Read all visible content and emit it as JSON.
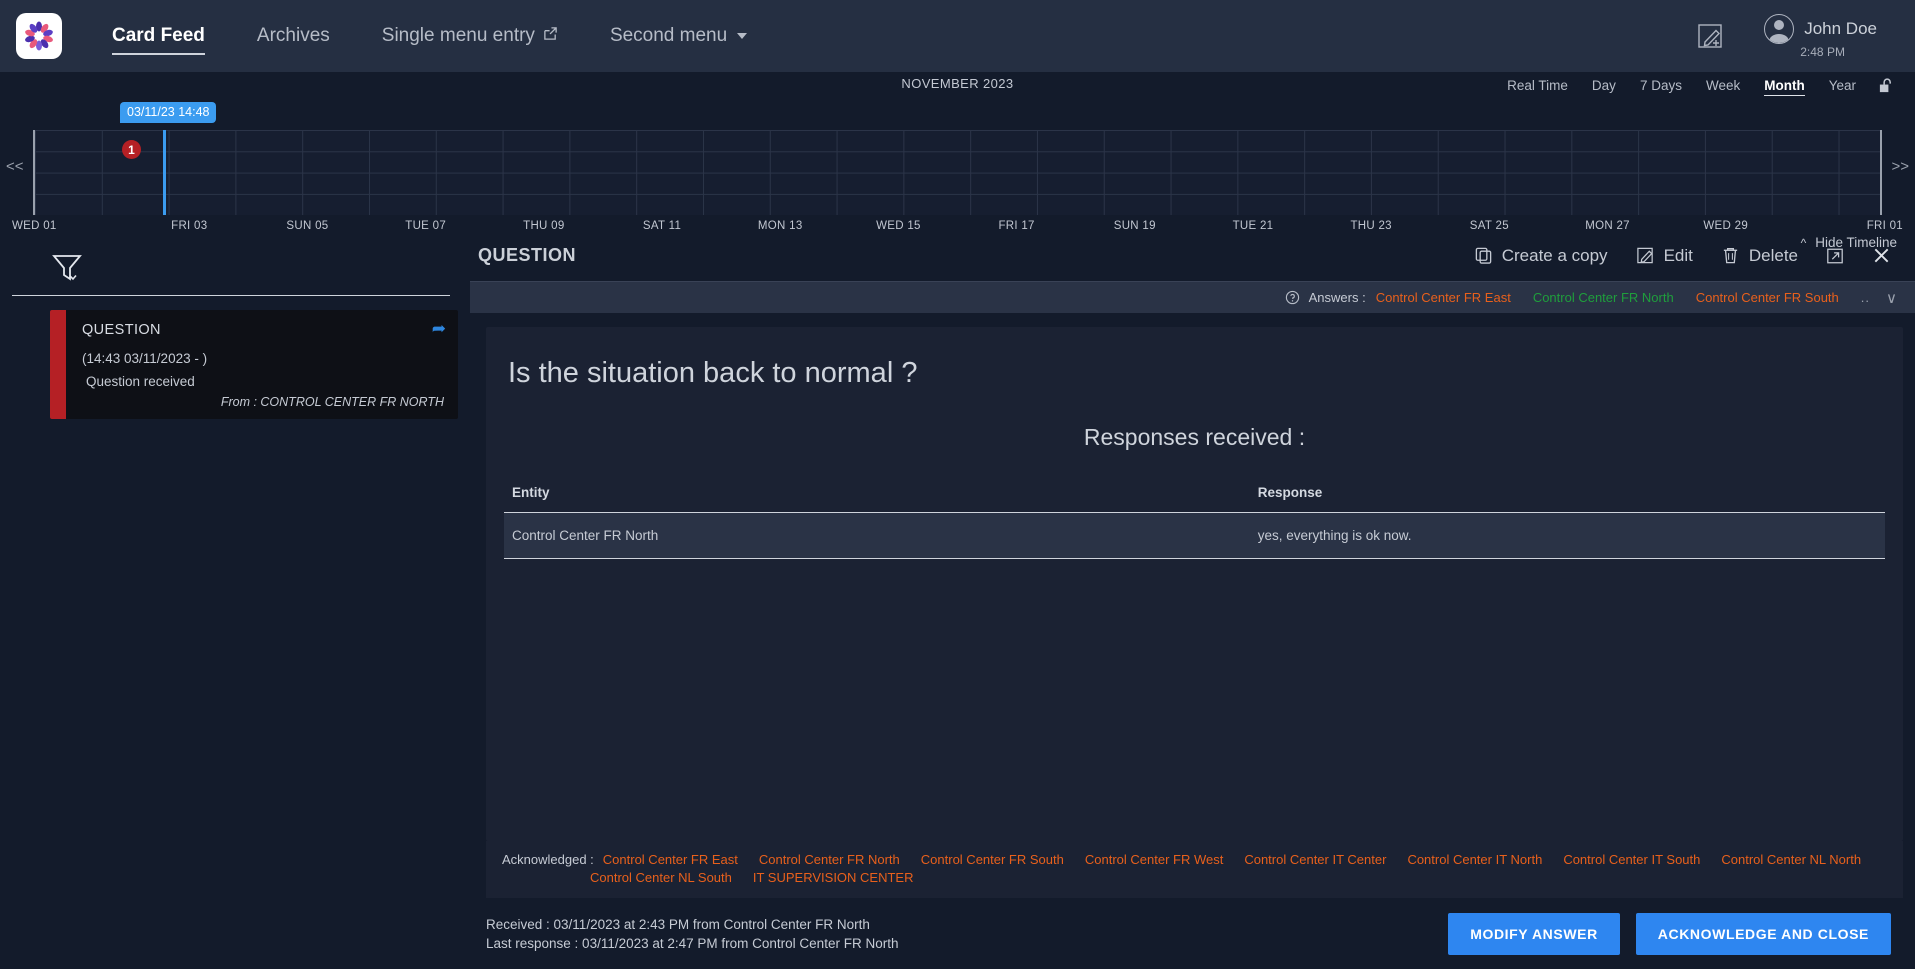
{
  "header": {
    "logo_icon": "flower-ring-logo",
    "nav": [
      {
        "label": "Card Feed",
        "active": true,
        "icon": null
      },
      {
        "label": "Archives",
        "active": false,
        "icon": null
      },
      {
        "label": "Single menu entry",
        "active": false,
        "icon": "external-link-icon"
      },
      {
        "label": "Second menu",
        "active": false,
        "icon": "chevron-down-icon"
      }
    ],
    "create_card_icon": "pencil-square-plus-icon",
    "user": {
      "name": "John Doe",
      "time": "2:48 PM",
      "avatar_icon": "user-avatar-icon"
    }
  },
  "timeline": {
    "month_label": "NOVEMBER 2023",
    "periods": [
      {
        "label": "Real Time",
        "active": false
      },
      {
        "label": "Day",
        "active": false
      },
      {
        "label": "7 Days",
        "active": false
      },
      {
        "label": "Week",
        "active": false
      },
      {
        "label": "Month",
        "active": true
      },
      {
        "label": "Year",
        "active": false
      }
    ],
    "lock_icon": "padlock-open-icon",
    "prev_label": "<<",
    "next_label": ">>",
    "cursor_label": "03/11/23 14:48",
    "marker_count": "1",
    "ticks": [
      "WED 01",
      "FRI 03",
      "SUN 05",
      "TUE 07",
      "THU 09",
      "SAT 11",
      "MON 13",
      "WED 15",
      "FRI 17",
      "SUN 19",
      "TUE 21",
      "THU 23",
      "SAT 25",
      "MON 27",
      "WED 29",
      "FRI 01"
    ],
    "hide_label": "Hide Timeline",
    "hide_chevron": "^"
  },
  "sidebar": {
    "filter_icon": "funnel-filter-icon",
    "card": {
      "title": "QUESTION",
      "time": "(14:43 03/11/2023 - )",
      "status": "Question received",
      "from": "From : CONTROL CENTER FR NORTH",
      "reply_icon": "reply-arrow-icon",
      "bar_color": "#b52025"
    }
  },
  "detail": {
    "title": "QUESTION",
    "actions": [
      {
        "label": "Create a copy",
        "icon": "copy-icon"
      },
      {
        "label": "Edit",
        "icon": "pencil-icon"
      },
      {
        "label": "Delete",
        "icon": "trash-icon"
      }
    ],
    "maximize_icon": "expand-arrow-icon",
    "close_icon": "close-icon",
    "answers": {
      "help_icon": "question-mark-circle-icon",
      "label": "Answers :",
      "chips": [
        {
          "label": "Control Center FR East",
          "color": "#e8601c"
        },
        {
          "label": "Control Center FR North",
          "color": "#1f9e3c"
        },
        {
          "label": "Control Center FR South",
          "color": "#e8601c"
        }
      ],
      "overflow": "..",
      "chevron": "∨"
    },
    "question_text": "Is the situation back to normal ?",
    "responses_heading": "Responses received :",
    "table": {
      "columns": [
        "Entity",
        "Response"
      ],
      "rows": [
        {
          "entity": "Control Center FR North",
          "response": "yes, everything is ok now."
        }
      ]
    },
    "acknowledged": {
      "label": "Acknowledged :",
      "entities": [
        "Control Center FR East",
        "Control Center FR North",
        "Control Center FR South",
        "Control Center FR West",
        "Control Center IT Center",
        "Control Center IT North",
        "Control Center IT South",
        "Control Center NL North",
        "Control Center NL South",
        "IT SUPERVISION CENTER"
      ],
      "color": "#e8601c"
    },
    "footer": {
      "received": "Received : 03/11/2023 at 2:43 PM from Control Center FR North",
      "last_response": "Last response : 03/11/2023 at 2:47 PM from Control Center FR North",
      "modify_button": "MODIFY ANSWER",
      "acknowledge_button": "ACKNOWLEDGE AND CLOSE",
      "button_color": "#2e86f0"
    }
  }
}
